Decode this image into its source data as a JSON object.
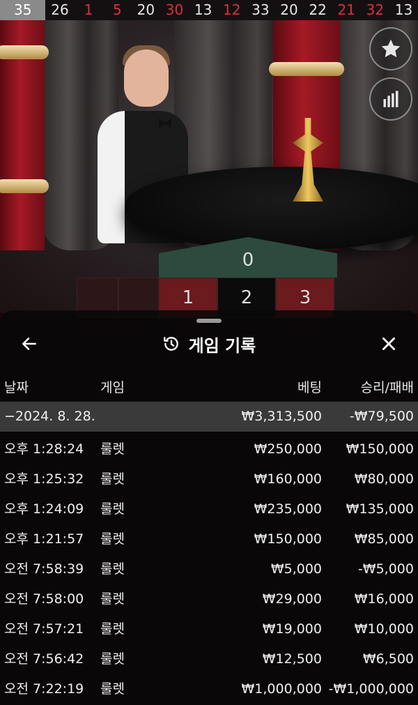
{
  "recent_results": [
    {
      "value": "35",
      "color": "latest"
    },
    {
      "value": "26",
      "color": "black"
    },
    {
      "value": "1",
      "color": "red"
    },
    {
      "value": "5",
      "color": "red"
    },
    {
      "value": "20",
      "color": "black"
    },
    {
      "value": "30",
      "color": "red"
    },
    {
      "value": "13",
      "color": "black"
    },
    {
      "value": "12",
      "color": "red"
    },
    {
      "value": "33",
      "color": "black"
    },
    {
      "value": "20",
      "color": "black"
    },
    {
      "value": "22",
      "color": "black"
    },
    {
      "value": "21",
      "color": "red"
    },
    {
      "value": "32",
      "color": "red"
    },
    {
      "value": "13",
      "color": "black"
    }
  ],
  "side_buttons": {
    "favorite_icon": "star-icon",
    "stats_icon": "bar-chart-icon"
  },
  "table_numbers": {
    "zero": "0",
    "row1": [
      "1",
      "2",
      "3"
    ]
  },
  "sheet": {
    "title": "게임 기록",
    "back_icon": "arrow-left-icon",
    "history_icon": "history-icon",
    "close_icon": "close-icon",
    "columns": {
      "date": "날짜",
      "game": "게임",
      "bet": "베팅",
      "win_loss": "승리/패배"
    },
    "summary": {
      "date": "−2024. 8. 28.",
      "bet": "₩3,313,500",
      "win_loss": "-₩79,500"
    },
    "rows": [
      {
        "time": "오후 1:28:24",
        "game": "룰렛",
        "bet": "₩250,000",
        "win_loss": "₩150,000"
      },
      {
        "time": "오후 1:25:32",
        "game": "룰렛",
        "bet": "₩160,000",
        "win_loss": "₩80,000"
      },
      {
        "time": "오후 1:24:09",
        "game": "룰렛",
        "bet": "₩235,000",
        "win_loss": "₩135,000"
      },
      {
        "time": "오후 1:21:57",
        "game": "룰렛",
        "bet": "₩150,000",
        "win_loss": "₩85,000"
      },
      {
        "time": "오전 7:58:39",
        "game": "룰렛",
        "bet": "₩5,000",
        "win_loss": "-₩5,000"
      },
      {
        "time": "오전 7:58:00",
        "game": "룰렛",
        "bet": "₩29,000",
        "win_loss": "₩16,000"
      },
      {
        "time": "오전 7:57:21",
        "game": "룰렛",
        "bet": "₩19,000",
        "win_loss": "₩10,000"
      },
      {
        "time": "오전 7:56:42",
        "game": "룰렛",
        "bet": "₩12,500",
        "win_loss": "₩6,500"
      },
      {
        "time": "오전 7:22:19",
        "game": "룰렛",
        "bet": "₩1,000,000",
        "win_loss": "-₩1,000,000"
      }
    ]
  },
  "colors": {
    "red_number": "#d8313c",
    "sheet_bg": "#080808",
    "summary_bg": "#3a3a3a",
    "zero_green": "#2c4a3e"
  }
}
